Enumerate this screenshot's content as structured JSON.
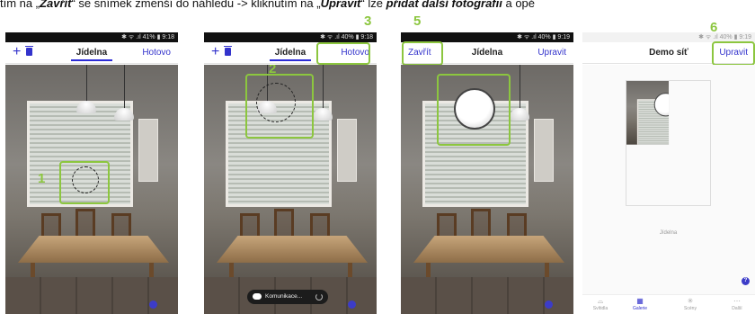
{
  "caption": {
    "prefix": "tím na „",
    "close_word": "Zavřít",
    "middle": "“ se snímek zmenší do náhledu -> kliknutím na „",
    "edit_word": "Upravit",
    "middle2": "“ lze ",
    "action": "přidat další fotografii",
    "suffix": " a opě"
  },
  "steps": [
    "1",
    "2",
    "3",
    "5",
    "6"
  ],
  "phone1": {
    "status": "✱ ᯤ .ıl 41% ▮ 9:18",
    "title": "Jídelna",
    "right": "Hotovo"
  },
  "phone2": {
    "status": "✱ ᯤ .ıl 40% ▮ 9:18",
    "title": "Jídelna",
    "right": "Hotovo",
    "toast": "Komunikace..."
  },
  "phone3": {
    "status": "✱ ᯤ .ıl 40% ▮ 9:19",
    "left": "Zavřít",
    "title": "Jídelna",
    "right": "Upravit"
  },
  "phone4": {
    "status": "✱ ᯤ .ıl 40% ▮ 9:19",
    "title": "Demo síť",
    "right": "Upravit",
    "thumb_label": "Jídelna",
    "help": "?",
    "tabs": [
      {
        "label": "Svítidla",
        "icon": "lamp-icon",
        "glyph": "⌓"
      },
      {
        "label": "Galerie",
        "icon": "grid-icon",
        "glyph": "▦"
      },
      {
        "label": "Scény",
        "icon": "sun-icon",
        "glyph": "✳"
      },
      {
        "label": "Další",
        "icon": "more-icon",
        "glyph": "⋯"
      }
    ]
  },
  "colors": {
    "accent_green": "#8cc63f",
    "link_blue": "#3333cc"
  }
}
